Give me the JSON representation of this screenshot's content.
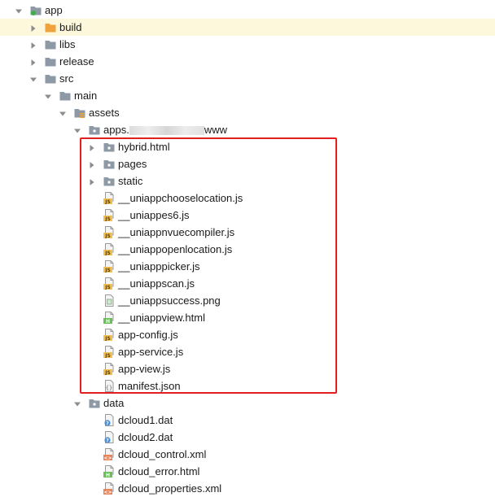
{
  "tree": [
    {
      "label": "app",
      "type": "module",
      "depth": 0,
      "expanded": true,
      "selected": false
    },
    {
      "label": "build",
      "type": "folder-orange",
      "depth": 1,
      "expanded": false,
      "selected": true
    },
    {
      "label": "libs",
      "type": "folder",
      "depth": 1,
      "expanded": false
    },
    {
      "label": "release",
      "type": "folder",
      "depth": 1,
      "expanded": false
    },
    {
      "label": "src",
      "type": "folder",
      "depth": 1,
      "expanded": true
    },
    {
      "label": "main",
      "type": "folder",
      "depth": 2,
      "expanded": true
    },
    {
      "label": "assets",
      "type": "folder-resource",
      "depth": 3,
      "expanded": true
    },
    {
      "label": "apps.",
      "label_suffix": "www",
      "type": "folder-dot",
      "depth": 4,
      "expanded": true,
      "redacted": true
    },
    {
      "label": "hybrid.html",
      "type": "folder-dot",
      "depth": 5,
      "expanded": false
    },
    {
      "label": "pages",
      "type": "folder-dot",
      "depth": 5,
      "expanded": false
    },
    {
      "label": "static",
      "type": "folder-dot",
      "depth": 5,
      "expanded": false
    },
    {
      "label": "__uniappchooselocation.js",
      "type": "js",
      "depth": 5
    },
    {
      "label": "__uniappes6.js",
      "type": "js",
      "depth": 5
    },
    {
      "label": "__uniappnvuecompiler.js",
      "type": "js",
      "depth": 5
    },
    {
      "label": "__uniappopenlocation.js",
      "type": "js",
      "depth": 5
    },
    {
      "label": "__uniapppicker.js",
      "type": "js",
      "depth": 5
    },
    {
      "label": "__uniappscan.js",
      "type": "js",
      "depth": 5
    },
    {
      "label": "__uniappsuccess.png",
      "type": "png",
      "depth": 5
    },
    {
      "label": "__uniappview.html",
      "type": "html",
      "depth": 5
    },
    {
      "label": "app-config.js",
      "type": "js",
      "depth": 5
    },
    {
      "label": "app-service.js",
      "type": "js",
      "depth": 5
    },
    {
      "label": "app-view.js",
      "type": "js",
      "depth": 5
    },
    {
      "label": "manifest.json",
      "type": "json",
      "depth": 5
    },
    {
      "label": "data",
      "type": "folder-dot",
      "depth": 4,
      "expanded": true
    },
    {
      "label": "dcloud1.dat",
      "type": "unknown",
      "depth": 5
    },
    {
      "label": "dcloud2.dat",
      "type": "unknown",
      "depth": 5
    },
    {
      "label": "dcloud_control.xml",
      "type": "xml",
      "depth": 5
    },
    {
      "label": "dcloud_error.html",
      "type": "html",
      "depth": 5
    },
    {
      "label": "dcloud_properties.xml",
      "type": "xml",
      "depth": 5
    }
  ],
  "colors": {
    "selected_row": "#fdf8dc",
    "highlight_border": "#e51f1f",
    "folder": "#8d9aa6",
    "folder_orange": "#f0a33c"
  }
}
